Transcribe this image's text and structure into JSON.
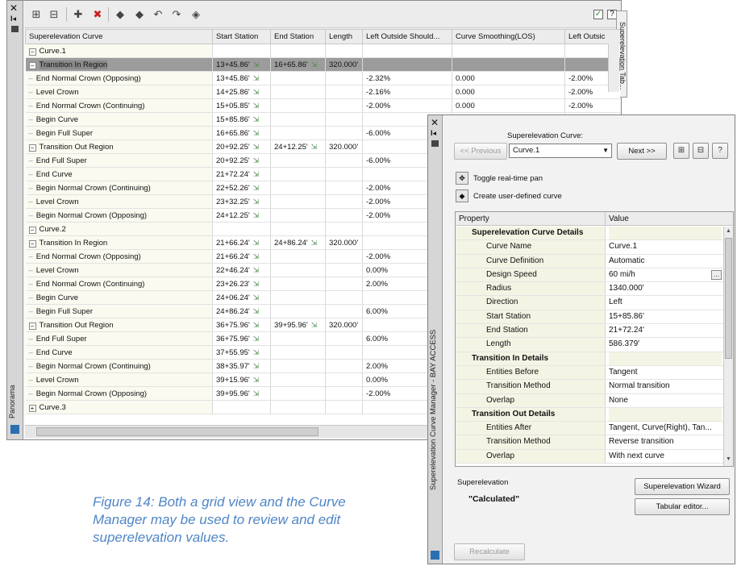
{
  "grid_window": {
    "side_title": "Panorama",
    "side_tab": "Superelevation Tab...",
    "columns": [
      "Superelevation Curve",
      "Start Station",
      "End Station",
      "Length",
      "Left Outside Should...",
      "Curve Smoothing(LOS)",
      "Left Outsic"
    ],
    "rows": [
      {
        "level": 0,
        "ctl": "−",
        "name": "Curve.1",
        "start": "",
        "end": "",
        "length": "",
        "lo": "",
        "cs": "",
        "lo2": ""
      },
      {
        "level": 1,
        "ctl": "−",
        "name": "Transition In Region",
        "start": "13+45.86'",
        "end": "16+65.86'",
        "length": "320.000'",
        "lo": "",
        "cs": "",
        "lo2": "",
        "selected": true
      },
      {
        "level": 2,
        "name": "End Normal Crown (Opposing)",
        "start": "13+45.86'",
        "end": "",
        "length": "",
        "lo": "-2.32%",
        "cs": "0.000",
        "lo2": "-2.00%"
      },
      {
        "level": 2,
        "name": "Level Crown",
        "start": "14+25.86'",
        "end": "",
        "length": "",
        "lo": "-2.16%",
        "cs": "0.000",
        "lo2": "-2.00%"
      },
      {
        "level": 2,
        "name": "End Normal Crown (Continuing)",
        "start": "15+05.85'",
        "end": "",
        "length": "",
        "lo": "-2.00%",
        "cs": "0.000",
        "lo2": "-2.00%"
      },
      {
        "level": 2,
        "name": "Begin Curve",
        "start": "15+85.86'",
        "end": "",
        "length": "",
        "lo": "",
        "cs": "",
        "lo2": ""
      },
      {
        "level": 2,
        "name": "Begin Full Super",
        "start": "16+65.86'",
        "end": "",
        "length": "",
        "lo": "-6.00%",
        "cs": "",
        "lo2": ""
      },
      {
        "level": 1,
        "ctl": "−",
        "name": "Transition Out Region",
        "start": "20+92.25'",
        "end": "24+12.25'",
        "length": "320.000'",
        "lo": "",
        "cs": "",
        "lo2": ""
      },
      {
        "level": 2,
        "name": "End Full Super",
        "start": "20+92.25'",
        "end": "",
        "length": "",
        "lo": "-6.00%",
        "cs": "",
        "lo2": ""
      },
      {
        "level": 2,
        "name": "End Curve",
        "start": "21+72.24'",
        "end": "",
        "length": "",
        "lo": "",
        "cs": "",
        "lo2": ""
      },
      {
        "level": 2,
        "name": "Begin Normal Crown (Continuing)",
        "start": "22+52.26'",
        "end": "",
        "length": "",
        "lo": "-2.00%",
        "cs": "",
        "lo2": ""
      },
      {
        "level": 2,
        "name": "Level Crown",
        "start": "23+32.25'",
        "end": "",
        "length": "",
        "lo": "-2.00%",
        "cs": "",
        "lo2": ""
      },
      {
        "level": 2,
        "name": "Begin Normal Crown (Opposing)",
        "start": "24+12.25'",
        "end": "",
        "length": "",
        "lo": "-2.00%",
        "cs": "",
        "lo2": ""
      },
      {
        "level": 0,
        "ctl": "−",
        "name": "Curve.2",
        "start": "",
        "end": "",
        "length": "",
        "lo": "",
        "cs": "",
        "lo2": ""
      },
      {
        "level": 1,
        "ctl": "−",
        "name": "Transition In Region",
        "start": "21+66.24'",
        "end": "24+86.24'",
        "length": "320.000'",
        "lo": "",
        "cs": "",
        "lo2": ""
      },
      {
        "level": 2,
        "name": "End Normal Crown (Opposing)",
        "start": "21+66.24'",
        "end": "",
        "length": "",
        "lo": "-2.00%",
        "cs": "",
        "lo2": ""
      },
      {
        "level": 2,
        "name": "Level Crown",
        "start": "22+46.24'",
        "end": "",
        "length": "",
        "lo": "0.00%",
        "cs": "",
        "lo2": ""
      },
      {
        "level": 2,
        "name": "End Normal Crown (Continuing)",
        "start": "23+26.23'",
        "end": "",
        "length": "",
        "lo": "2.00%",
        "cs": "",
        "lo2": ""
      },
      {
        "level": 2,
        "name": "Begin Curve",
        "start": "24+06.24'",
        "end": "",
        "length": "",
        "lo": "",
        "cs": "",
        "lo2": ""
      },
      {
        "level": 2,
        "name": "Begin Full Super",
        "start": "24+86.24'",
        "end": "",
        "length": "",
        "lo": "6.00%",
        "cs": "",
        "lo2": ""
      },
      {
        "level": 1,
        "ctl": "−",
        "name": "Transition Out Region",
        "start": "36+75.96'",
        "end": "39+95.96'",
        "length": "320.000'",
        "lo": "",
        "cs": "",
        "lo2": ""
      },
      {
        "level": 2,
        "name": "End Full Super",
        "start": "36+75.96'",
        "end": "",
        "length": "",
        "lo": "6.00%",
        "cs": "",
        "lo2": ""
      },
      {
        "level": 2,
        "name": "End Curve",
        "start": "37+55.95'",
        "end": "",
        "length": "",
        "lo": "",
        "cs": "",
        "lo2": ""
      },
      {
        "level": 2,
        "name": "Begin Normal Crown (Continuing)",
        "start": "38+35.97'",
        "end": "",
        "length": "",
        "lo": "2.00%",
        "cs": "",
        "lo2": ""
      },
      {
        "level": 2,
        "name": "Level Crown",
        "start": "39+15.96'",
        "end": "",
        "length": "",
        "lo": "0.00%",
        "cs": "",
        "lo2": ""
      },
      {
        "level": 2,
        "name": "Begin Normal Crown (Opposing)",
        "start": "39+95.96'",
        "end": "",
        "length": "",
        "lo": "-2.00%",
        "cs": "",
        "lo2": ""
      },
      {
        "level": 0,
        "ctl": "+",
        "name": "Curve.3",
        "start": "",
        "end": "",
        "length": "",
        "lo": "",
        "cs": "",
        "lo2": ""
      }
    ]
  },
  "manager": {
    "side_title": "Superelevation Curve Manager - BAY ACCESS",
    "curve_label": "Superelevation Curve:",
    "curve_value": "Curve.1",
    "prev_label": "<< Previous",
    "next_label": "Next >>",
    "toggle_label": "Toggle real-time pan",
    "create_label": "Create user-defined curve",
    "prop_header": "Property",
    "value_header": "Value",
    "properties": [
      {
        "cat": true,
        "k": "Superelevation Curve Details",
        "v": ""
      },
      {
        "k": "Curve Name",
        "v": "Curve.1"
      },
      {
        "k": "Curve Definition",
        "v": "Automatic"
      },
      {
        "k": "Design Speed",
        "v": "60 mi/h",
        "ellipsis": true
      },
      {
        "k": "Radius",
        "v": "1340.000'"
      },
      {
        "k": "Direction",
        "v": "Left"
      },
      {
        "k": "Start Station",
        "v": "15+85.86'"
      },
      {
        "k": "End Station",
        "v": "21+72.24'"
      },
      {
        "k": "Length",
        "v": "586.379'"
      },
      {
        "cat": true,
        "k": "Transition In Details",
        "v": ""
      },
      {
        "k": "Entities Before",
        "v": "Tangent"
      },
      {
        "k": "Transition Method",
        "v": "Normal transition"
      },
      {
        "k": "Overlap",
        "v": "None"
      },
      {
        "cat": true,
        "k": "Transition Out Details",
        "v": ""
      },
      {
        "k": "Entities After",
        "v": "Tangent, Curve(Right), Tan..."
      },
      {
        "k": "Transition Method",
        "v": "Reverse transition"
      },
      {
        "k": "Overlap",
        "v": "With next curve"
      }
    ],
    "superelevation_label": "Superelevation",
    "superelevation_value": "\"Calculated\"",
    "wizard_label": "Superelevation Wizard",
    "tabular_label": "Tabular editor...",
    "recalc_label": "Recalculate"
  },
  "caption": "Figure 14: Both a grid view and the Curve Manager may be used to review and edit superelevation values."
}
